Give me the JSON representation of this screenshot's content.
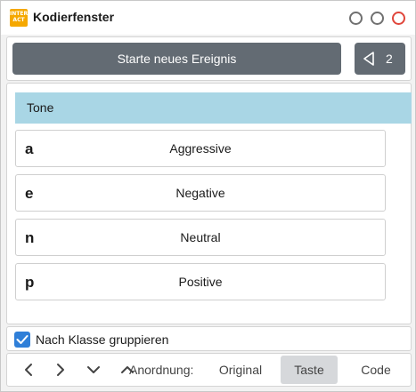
{
  "window": {
    "title": "Kodierfenster",
    "icon": "interact-app-icon",
    "icon_text": "INTER ACT"
  },
  "toolbar": {
    "start_label": "Starte neues Ereignis",
    "nav_count": "2"
  },
  "group": {
    "name": "Tone"
  },
  "codes": [
    {
      "key": "a",
      "label": "Aggressive"
    },
    {
      "key": "e",
      "label": "Negative"
    },
    {
      "key": "n",
      "label": "Neutral"
    },
    {
      "key": "p",
      "label": "Positive"
    }
  ],
  "group_by_class": {
    "label": "Nach Klasse gruppieren",
    "checked": true
  },
  "bottom": {
    "sort_label": "Anordnung:",
    "options": [
      "Original",
      "Taste",
      "Code"
    ],
    "active_option": "Taste"
  },
  "colors": {
    "button": "#636b73",
    "group_header": "#a9d6e5",
    "checkbox": "#2f7fd8",
    "close": "#e0463b"
  }
}
